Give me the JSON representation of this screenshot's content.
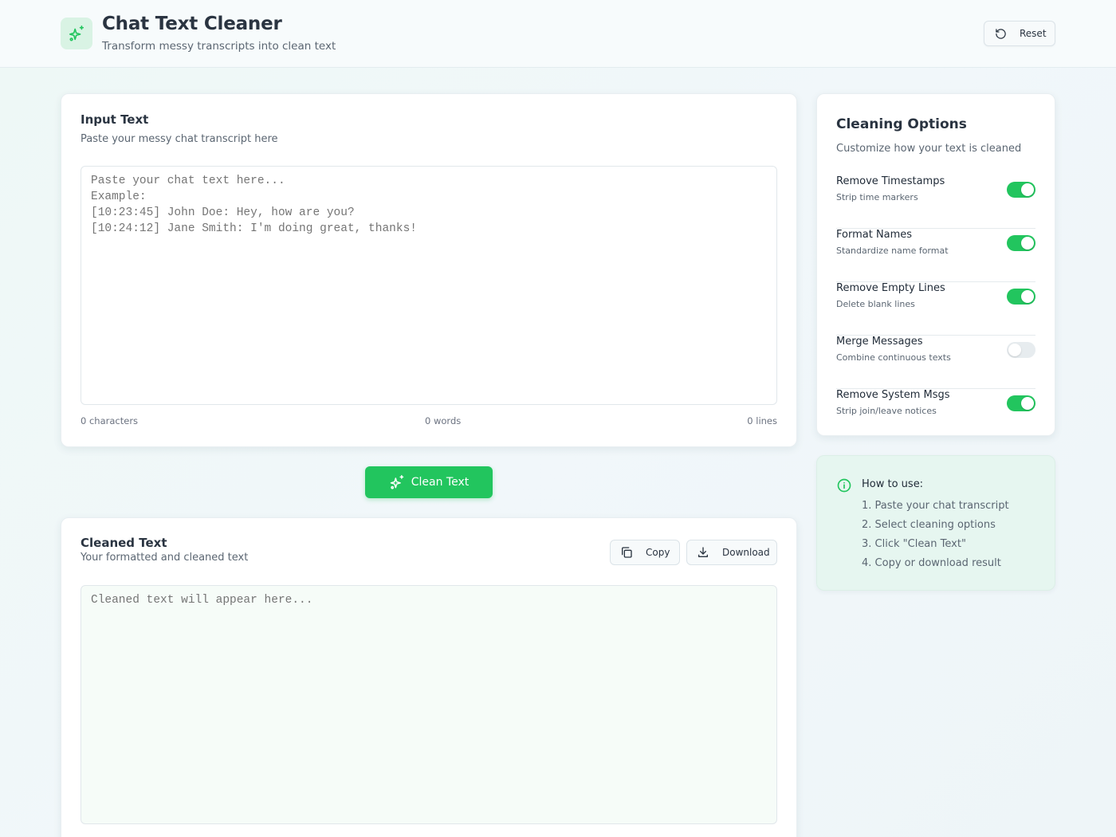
{
  "header": {
    "title": "Chat Text Cleaner",
    "subtitle": "Transform messy transcripts into clean text",
    "reset_label": "Reset"
  },
  "input": {
    "title": "Input Text",
    "subtitle": "Paste your messy chat transcript here",
    "placeholder": "Paste your chat text here...\nExample:\n[10:23:45] John Doe: Hey, how are you?\n[10:24:12] Jane Smith: I'm doing great, thanks!",
    "value": "",
    "stats": {
      "characters": "0 characters",
      "words": "0 words",
      "lines": "0 lines"
    }
  },
  "clean_button": {
    "label": "Clean Text"
  },
  "output": {
    "title": "Cleaned Text",
    "subtitle": "Your formatted and cleaned text",
    "copy_label": "Copy",
    "download_label": "Download",
    "placeholder": "Cleaned text will appear here...",
    "value": ""
  },
  "options": {
    "title": "Cleaning Options",
    "subtitle": "Customize how your text is cleaned",
    "items": [
      {
        "label": "Remove Timestamps",
        "description": "Strip time markers",
        "enabled": true
      },
      {
        "label": "Format Names",
        "description": "Standardize name format",
        "enabled": true
      },
      {
        "label": "Remove Empty Lines",
        "description": "Delete blank lines",
        "enabled": true
      },
      {
        "label": "Merge Messages",
        "description": "Combine continuous texts",
        "enabled": false
      },
      {
        "label": "Remove System Msgs",
        "description": "Strip join/leave notices",
        "enabled": true
      }
    ]
  },
  "howto": {
    "title": "How to use:",
    "steps": [
      "1. Paste your chat transcript",
      "2. Select cleaning options",
      "3. Click \"Clean Text\"",
      "4. Copy or download result"
    ]
  },
  "colors": {
    "accent": "#22c55e",
    "toggle_off": "#e7ecef",
    "howto_bg": "#e6f6f0"
  },
  "icons": {
    "logo": "sparkles-icon",
    "reset": "rotate-ccw-icon",
    "clean": "sparkles-icon",
    "copy": "copy-icon",
    "download": "download-icon",
    "info": "info-icon"
  }
}
